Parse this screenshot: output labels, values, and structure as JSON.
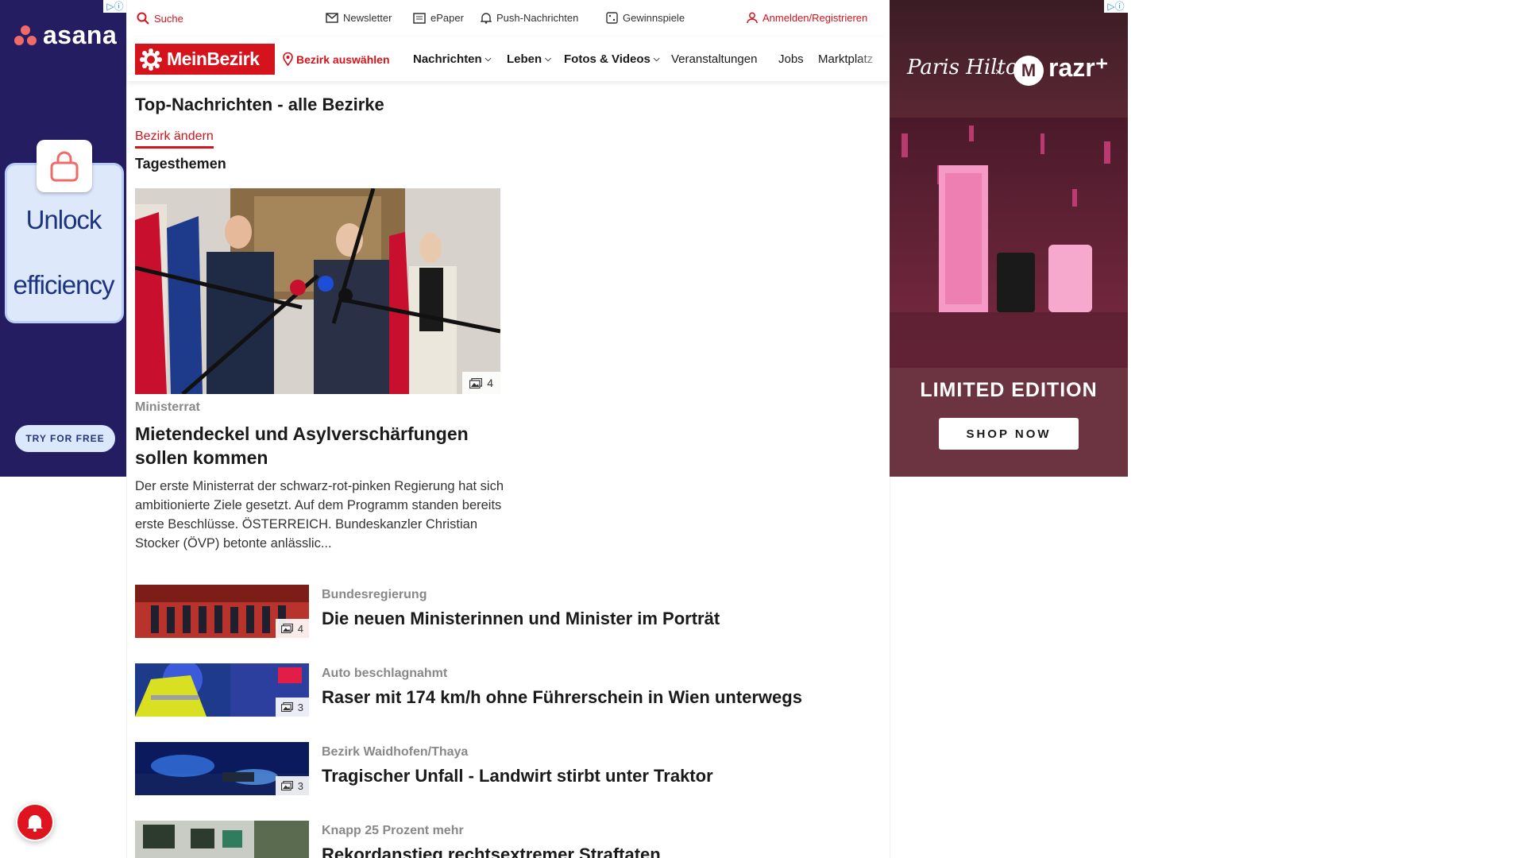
{
  "colors": {
    "brand_red": "#d5131c",
    "asana_bg": "#241d62",
    "razr_bg": "#6b3440"
  },
  "ad_left": {
    "brand": "asana",
    "headline_line1": "Unlock",
    "headline_line2": "efficiency",
    "cta": "TRY FOR FREE",
    "adchoices": "▷ⓘ"
  },
  "topbar": {
    "search": "Suche",
    "newsletter": "Newsletter",
    "epaper": "ePaper",
    "push": "Push-Nachrichten",
    "gewinnspiele": "Gewinnspiele",
    "login": "Anmelden/Registrieren"
  },
  "nav": {
    "logo": "MeinBezirk",
    "bezirk": "Bezirk auswählen",
    "items": [
      "Nachrichten",
      "Leben",
      "Fotos & Videos",
      "Veranstaltungen",
      "Jobs",
      "Marktplatz"
    ]
  },
  "page": {
    "title": "Top-Nachrichten - alle Bezirke",
    "change_link": "Bezirk ändern",
    "section": "Tagesthemen"
  },
  "lead": {
    "kicker": "Ministerrat",
    "headline": "Mietendeckel und Asylverschärfungen sollen kommen",
    "teaser": "Der erste Ministerrat der schwarz-rot-pinken Regierung hat sich ambitionierte Ziele gesetzt. Auf dem Programm standen bereits erste Beschlüsse. ÖSTERREICH. Bundeskanzler Christian Stocker (ÖVP) betonte anlässlic...",
    "image_count": "4"
  },
  "articles": [
    {
      "kicker": "Bundesregierung",
      "title": "Die neuen Ministerinnen und Minister im Porträt",
      "image_count": "4"
    },
    {
      "kicker": "Auto beschlagnahmt",
      "title": "Raser mit 174 km/h ohne Führerschein in Wien unterwegs",
      "image_count": "3"
    },
    {
      "kicker": "Bezirk Waidhofen/Thaya",
      "title": "Tragischer Unfall - Landwirt stirbt unter Traktor",
      "image_count": "3"
    },
    {
      "kicker": "Knapp 25 Prozent mehr",
      "title": "Rekordanstieg rechtsextremer Straftaten",
      "image_count": ""
    }
  ],
  "ad_right": {
    "collab_x": "×",
    "brand": "razr⁺",
    "headline": "LIMITED EDITION",
    "cta": "SHOP NOW",
    "adchoices": "▷ⓘ"
  }
}
